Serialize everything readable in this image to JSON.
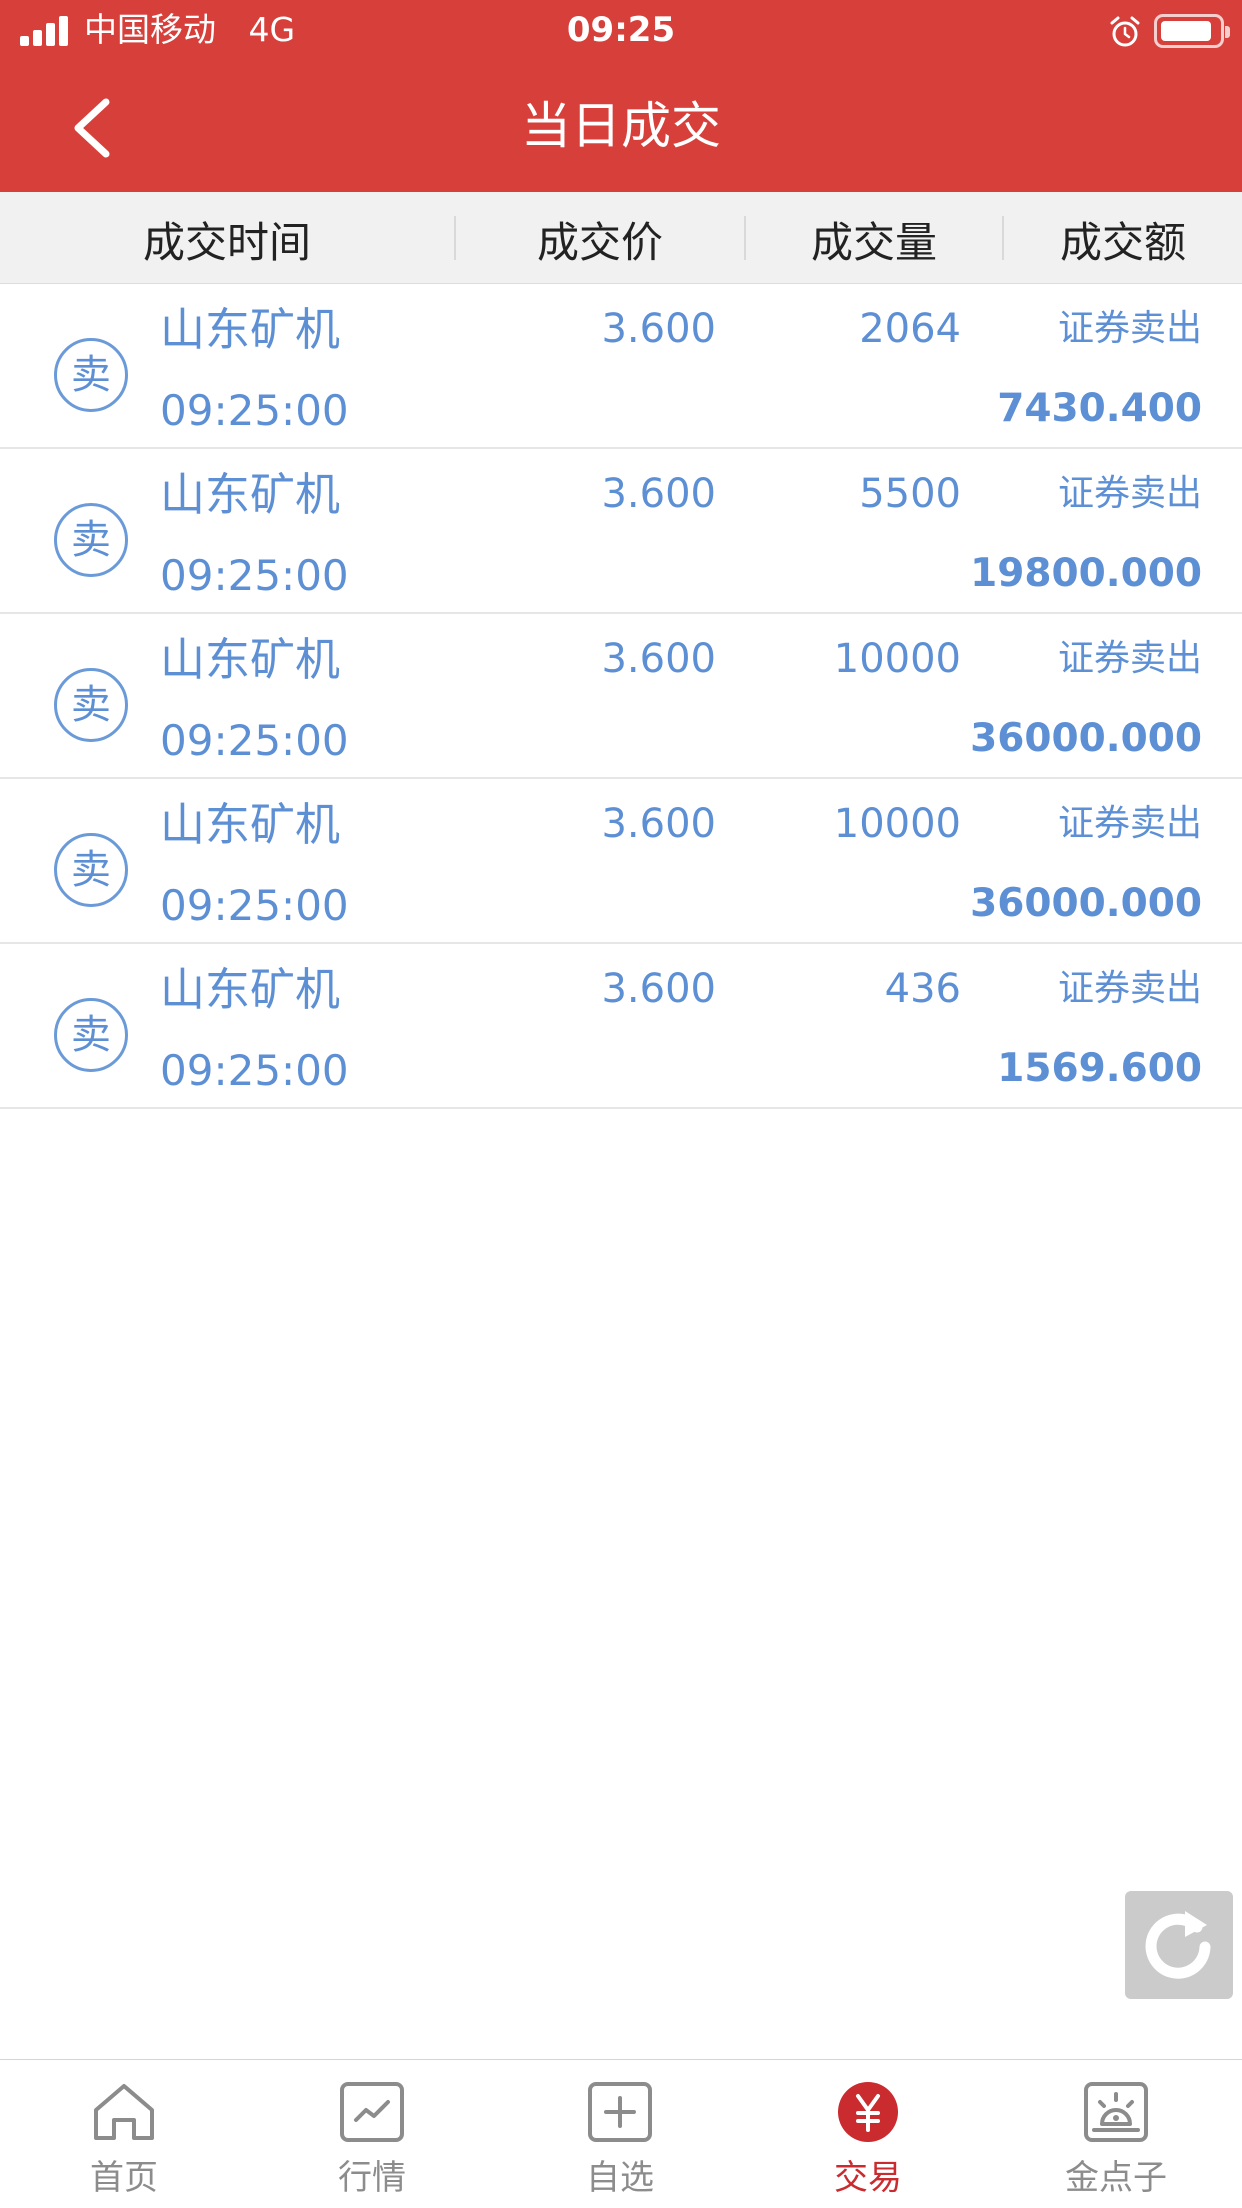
{
  "status_bar": {
    "carrier": "中国移动",
    "network": "4G",
    "time": "09:25"
  },
  "nav": {
    "title": "当日成交"
  },
  "table": {
    "headers": [
      "成交时间",
      "成交价",
      "成交量",
      "成交额"
    ],
    "rows": [
      {
        "badge": "卖",
        "name": "山东矿机",
        "time": "09:25:00",
        "price": "3.600",
        "volume": "2064",
        "direction": "证券卖出",
        "amount": "7430.400"
      },
      {
        "badge": "卖",
        "name": "山东矿机",
        "time": "09:25:00",
        "price": "3.600",
        "volume": "5500",
        "direction": "证券卖出",
        "amount": "19800.000"
      },
      {
        "badge": "卖",
        "name": "山东矿机",
        "time": "09:25:00",
        "price": "3.600",
        "volume": "10000",
        "direction": "证券卖出",
        "amount": "36000.000"
      },
      {
        "badge": "卖",
        "name": "山东矿机",
        "time": "09:25:00",
        "price": "3.600",
        "volume": "10000",
        "direction": "证券卖出",
        "amount": "36000.000"
      },
      {
        "badge": "卖",
        "name": "山东矿机",
        "time": "09:25:00",
        "price": "3.600",
        "volume": "436",
        "direction": "证券卖出",
        "amount": "1569.600"
      }
    ]
  },
  "tab_bar": {
    "tabs": [
      {
        "label": "首页",
        "icon": "home-icon",
        "active": false
      },
      {
        "label": "行情",
        "icon": "market-chart-icon",
        "active": false
      },
      {
        "label": "自选",
        "icon": "add-watchlist-icon",
        "active": false
      },
      {
        "label": "交易",
        "icon": "yuan-trade-icon",
        "active": true
      },
      {
        "label": "金点子",
        "icon": "idea-lamp-icon",
        "active": false
      }
    ]
  },
  "colors": {
    "brand_red": "#d73f3a",
    "row_blue": "#5d8fd4",
    "active_tab": "#c92b2f"
  }
}
